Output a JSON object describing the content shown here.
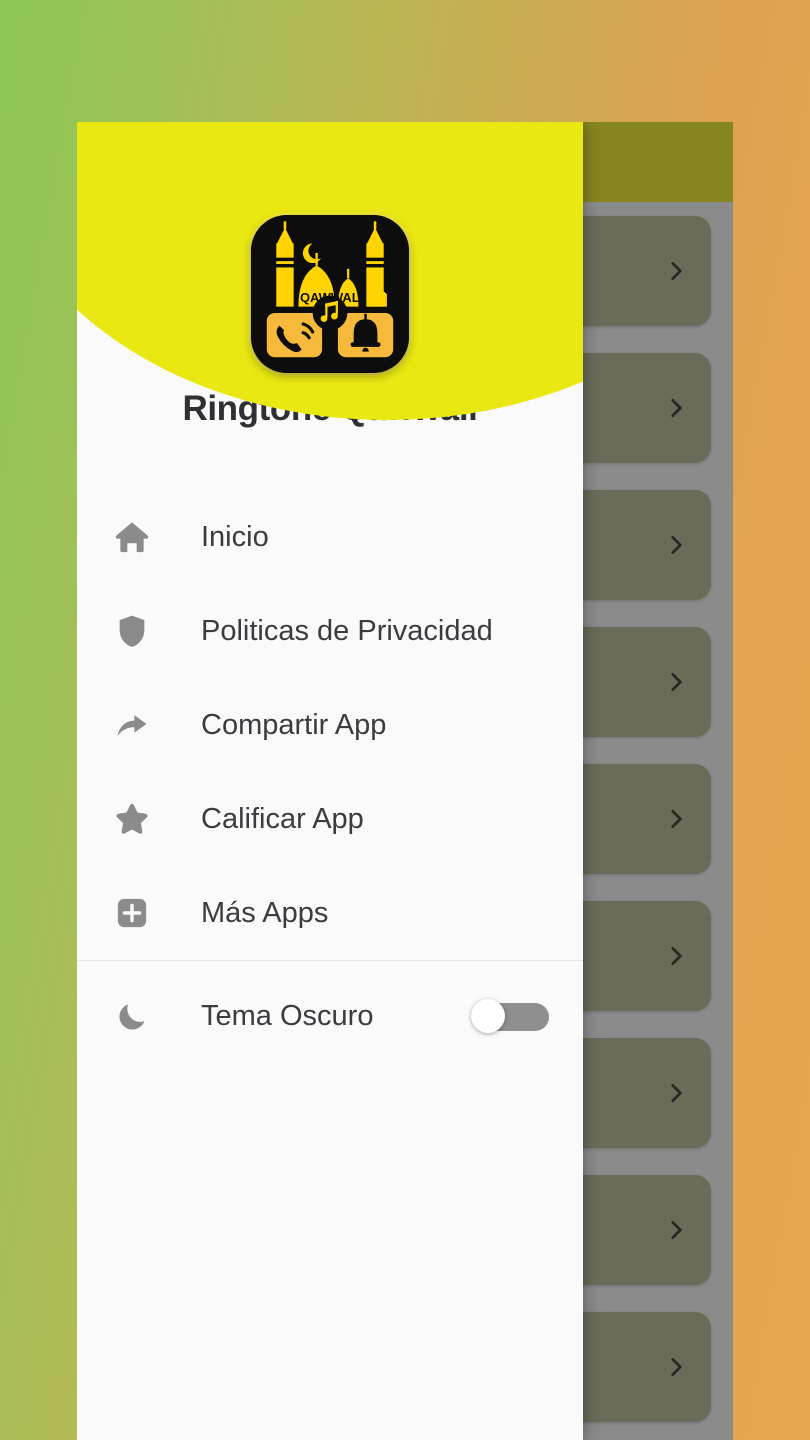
{
  "window": {
    "backdrop_gradient_from": "#8cc755",
    "backdrop_gradient_to": "#e5a64e",
    "toolbar_color": "#ecea16",
    "scrim_color": "rgba(40,40,40,0.52)"
  },
  "app_content": {
    "cards": [
      {
        "chevron_icon": "chevron-right-icon"
      },
      {
        "chevron_icon": "chevron-right-icon"
      },
      {
        "chevron_icon": "chevron-right-icon"
      },
      {
        "chevron_icon": "chevron-right-icon"
      },
      {
        "chevron_icon": "chevron-right-icon"
      },
      {
        "chevron_icon": "chevron-right-icon"
      },
      {
        "chevron_icon": "chevron-right-icon"
      },
      {
        "chevron_icon": "chevron-right-icon"
      },
      {
        "chevron_icon": "chevron-right-icon"
      }
    ]
  },
  "drawer": {
    "header": {
      "title": "Ringtone Qawwali",
      "logo_icon": "app-logo-qawwali",
      "logo_text": "QAWWALI",
      "blob_color": "#e9e813"
    },
    "items": [
      {
        "label": "Inicio",
        "icon": "home-icon"
      },
      {
        "label": "Politicas de Privacidad",
        "icon": "shield-icon"
      },
      {
        "label": "Compartir App",
        "icon": "share-arrow-icon"
      },
      {
        "label": "Calificar App",
        "icon": "star-icon"
      },
      {
        "label": "Más Apps",
        "icon": "plus-box-icon"
      }
    ],
    "theme": {
      "label": "Tema Oscuro",
      "icon": "moon-icon",
      "enabled": false
    },
    "icon_color": "#8b8b8b",
    "text_color": "#3a3c40"
  }
}
